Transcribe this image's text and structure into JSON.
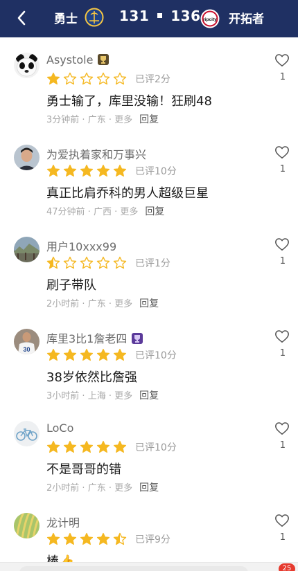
{
  "header": {
    "team_left": "勇士",
    "score_left": "131",
    "score_right": "136",
    "team_right": "开拓者",
    "team_right_logo_text": "ripcity",
    "colors": {
      "background": "#1f3063"
    }
  },
  "comments": [
    {
      "username": "Asystole",
      "badge": "gold-trophy",
      "rating": 1,
      "rating_text": "已评2分",
      "content": "勇士输了，库里没输！狂刷48",
      "time": "3分钟前",
      "region": "广东",
      "more": "更多",
      "reply": "回复",
      "likes": "1"
    },
    {
      "username": "为爱执着家和万事兴",
      "rating": 5,
      "rating_text": "已评10分",
      "content": "真正比肩乔科的男人超级巨星",
      "time": "47分钟前",
      "region": "广西",
      "more": "更多",
      "reply": "回复",
      "likes": "1"
    },
    {
      "username": "用户10xxx99",
      "rating": 0.5,
      "rating_text": "已评1分",
      "content": "刷子带队",
      "time": "2小时前",
      "region": "广东",
      "more": "更多",
      "reply": "回复",
      "likes": "1"
    },
    {
      "username": "库里3比1詹老四",
      "badge": "purple-trophy",
      "rating": 5,
      "rating_text": "已评10分",
      "content": "38岁依然比詹强",
      "time": "3小时前",
      "region": "上海",
      "more": "更多",
      "reply": "回复",
      "likes": "1"
    },
    {
      "username": "LoCo",
      "rating": 5,
      "rating_text": "已评10分",
      "content": "不是哥哥的错",
      "time": "2小时前",
      "region": "广东",
      "more": "更多",
      "reply": "回复",
      "likes": "1"
    },
    {
      "username": "龙计明",
      "rating": 4.5,
      "rating_text": "已评9分",
      "content": "棒👍",
      "likes": "1"
    }
  ],
  "bottom_bar": {
    "badge_count": "25"
  }
}
